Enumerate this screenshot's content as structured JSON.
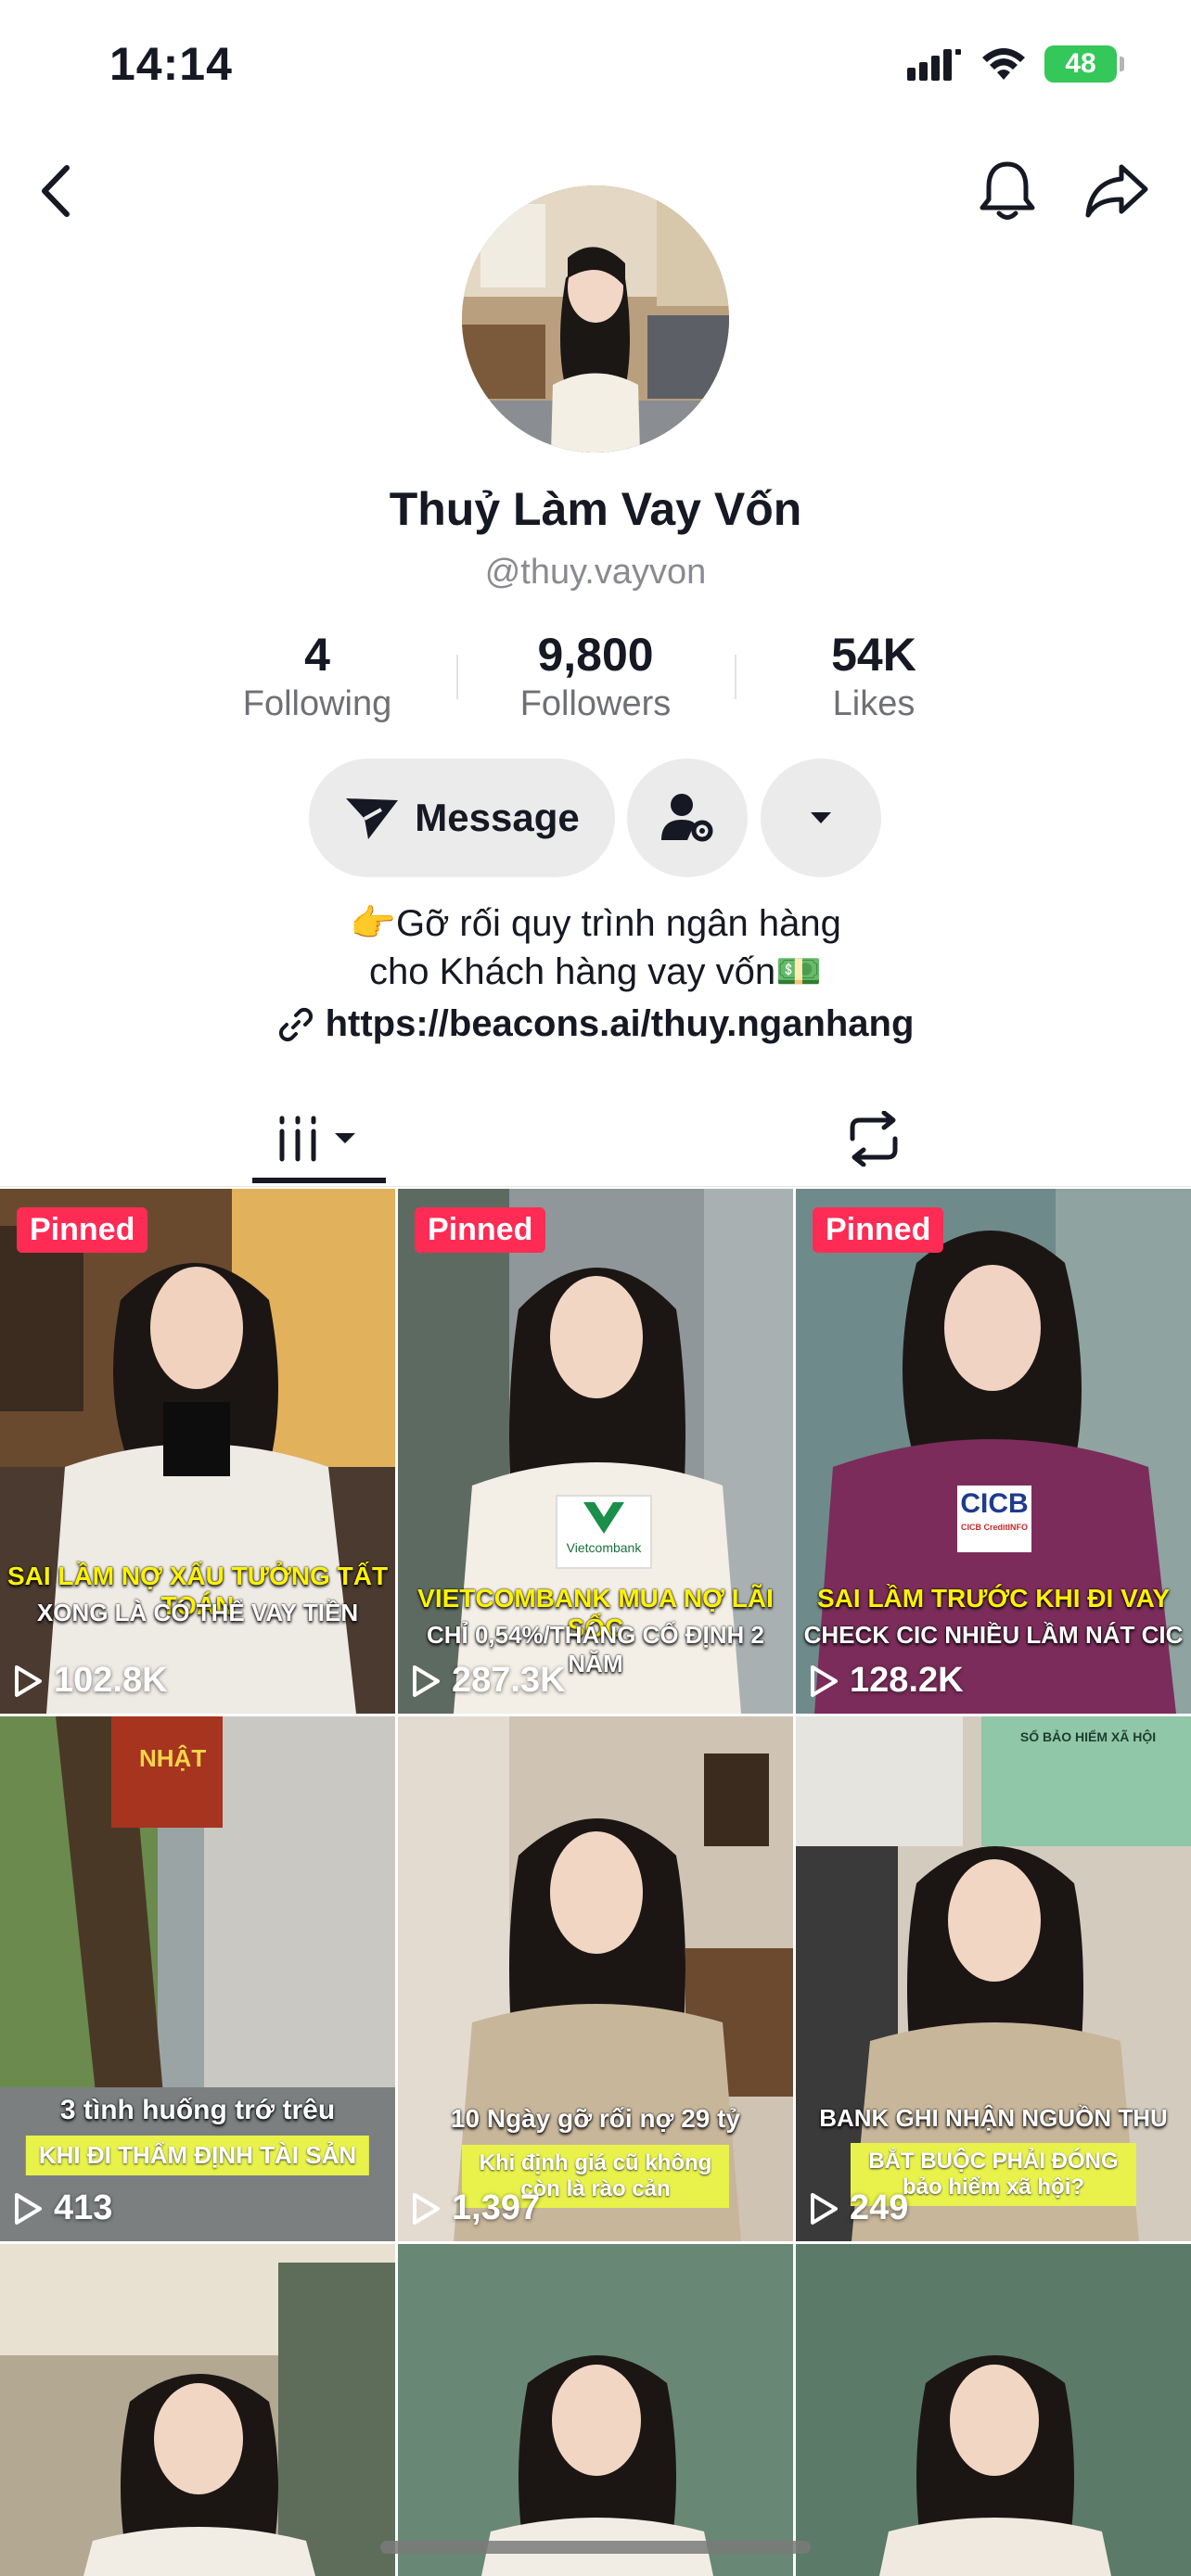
{
  "status_bar": {
    "time": "14:14",
    "battery": "48"
  },
  "profile": {
    "name": "Thuỷ Làm Vay Vốn",
    "handle": "@thuy.vayvon",
    "stats": [
      {
        "value": "4",
        "label": "Following"
      },
      {
        "value": "9,800",
        "label": "Followers"
      },
      {
        "value": "54K",
        "label": "Likes"
      }
    ],
    "message_label": "Message",
    "bio_line1": "👉Gỡ rối quy trình ngân hàng",
    "bio_line2": "cho Khách hàng vay vốn💵",
    "link": "https://beacons.ai/thuy.nganhang"
  },
  "videos": [
    {
      "pinned": "Pinned",
      "views": "102.8K",
      "caption1": "SAI LẦM NỢ XẤU TƯỞNG TẤT TOÁN",
      "caption2": "XONG LÀ CÓ THỂ VAY TIỀN"
    },
    {
      "pinned": "Pinned",
      "views": "287.3K",
      "caption1": "VIETCOMBANK MUA NỢ LÃI SỐC",
      "caption2": "CHỈ 0,54%/THÁNG CỐ ĐỊNH 2 NĂM",
      "logo": "Vietcombank"
    },
    {
      "pinned": "Pinned",
      "views": "128.2K",
      "caption1": "SAI LẦM TRƯỚC KHI ĐI VAY",
      "caption2": "CHECK CIC NHIỀU LẦM NÁT CIC",
      "logo": "CICB CreditINFO"
    },
    {
      "views": "413",
      "caption1": "3 tình huống trớ trêu",
      "caption2": "KHI ĐI THẨM ĐỊNH TÀI SẢN",
      "sign": "NHẬT"
    },
    {
      "views": "1,397",
      "caption1": "10 Ngày gỡ rối nợ 29 tỷ",
      "caption2": "Khi định giá cũ không còn là rào cản"
    },
    {
      "views": "249",
      "caption1": "BANK GHI NHẬN NGUỒN THU",
      "caption2": "BẮT BUỘC PHẢI ĐÓNG bảo hiểm xã hội?",
      "doc": "SỔ BẢO HIỂM XÃ HỘI"
    },
    {
      "views": ""
    },
    {
      "views": ""
    },
    {
      "views": ""
    }
  ],
  "colors": {
    "pinned": "#fe2c55",
    "battery": "#34c759",
    "caption_yellow": "#fff200"
  }
}
